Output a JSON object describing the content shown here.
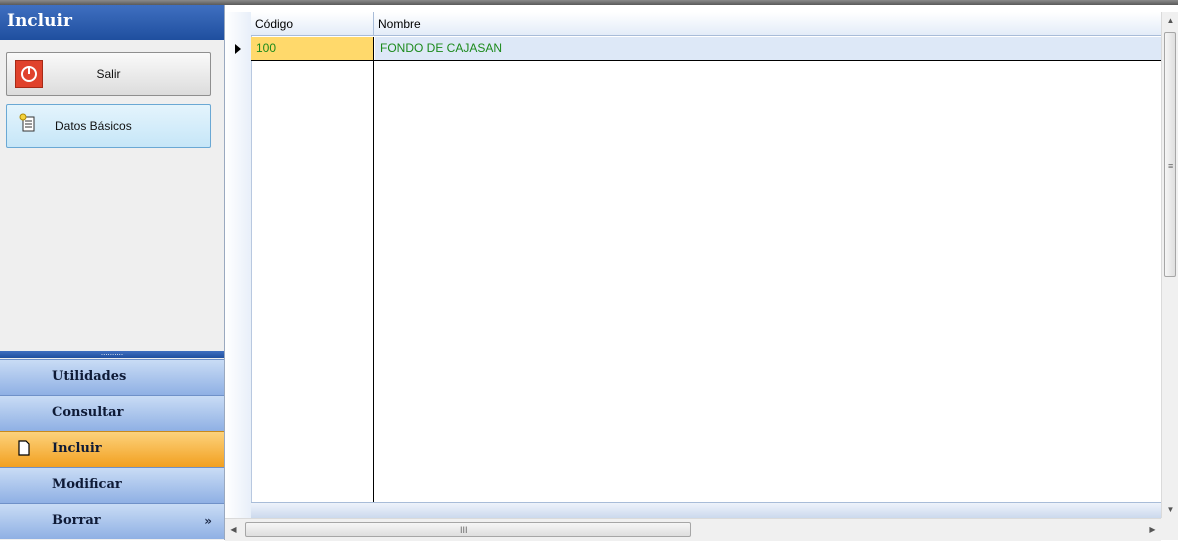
{
  "nav": {
    "header": "Incluir",
    "commands": [
      {
        "label": "Salir",
        "icon": "power-icon"
      },
      {
        "label": "Datos Básicos",
        "icon": "new-document-icon"
      }
    ],
    "splitter_grip": "..........",
    "sections": [
      {
        "label": "Utilidades",
        "active": false
      },
      {
        "label": "Consultar",
        "active": false
      },
      {
        "label": "Incluir",
        "active": true,
        "icon": "document-icon"
      },
      {
        "label": "Modificar",
        "active": false
      },
      {
        "label": "Borrar",
        "active": false,
        "icon": "chevron-double-down-icon"
      }
    ],
    "chevron": "»",
    "colors": {
      "header": "#2a5bb0",
      "active_section": "#f5b034"
    }
  },
  "grid": {
    "columns": [
      "Código",
      "Nombre"
    ],
    "rows": [
      {
        "codigo": "100",
        "nombre": "FONDO DE CAJASAN"
      }
    ],
    "text_color": "#1b8a1b",
    "selected_cell_color": "#ffd96b"
  },
  "scrollbars": {
    "up_arrow": "▲",
    "down_arrow": "▼",
    "left_arrow": "◀",
    "right_arrow": "▶",
    "v_grip": "≡",
    "h_grip": "III"
  }
}
